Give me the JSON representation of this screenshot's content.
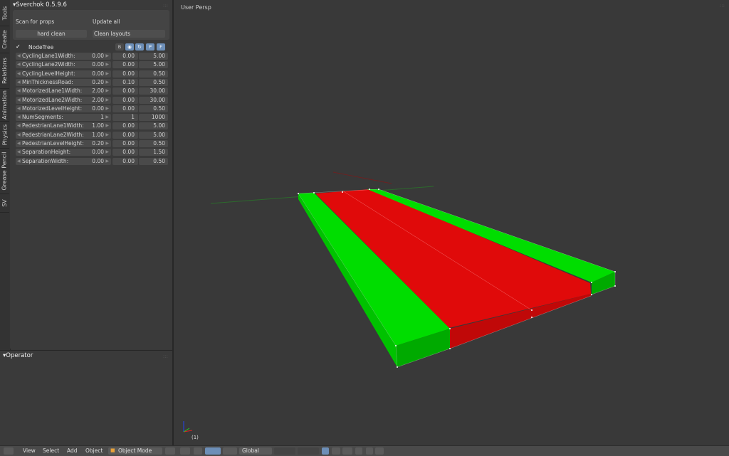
{
  "sidebar_tabs": [
    "Tools",
    "Create",
    "Relations",
    "Animation",
    "Physics",
    "Grease Pencil",
    "SV"
  ],
  "panel": {
    "title": "Sverchok 0.5.9.6",
    "scan_label": "Scan for props",
    "update_label": "Update all",
    "hard_clean_label": "hard clean",
    "clean_layouts_label": "Clean layouts",
    "nodetree_check": "✓",
    "nodetree_label": "NodeTree",
    "nodetree_buttons": {
      "b": "B",
      "p": "P",
      "f": "F"
    },
    "params": [
      {
        "name": "CyclingLane1Width:",
        "value": "0.00",
        "min": "0.00",
        "max": "5.00"
      },
      {
        "name": "CyclingLane2Width:",
        "value": "0.00",
        "min": "0.00",
        "max": "5.00"
      },
      {
        "name": "CyclingLevelHeight:",
        "value": "0.00",
        "min": "0.00",
        "max": "0.50"
      },
      {
        "name": "MinThicknessRoad:",
        "value": "0.20",
        "min": "0.10",
        "max": "0.50"
      },
      {
        "name": "MotorizedLane1Width:",
        "value": "2.00",
        "min": "0.00",
        "max": "30.00"
      },
      {
        "name": "MotorizedLane2Width:",
        "value": "2.00",
        "min": "0.00",
        "max": "30.00"
      },
      {
        "name": "MotorizedLevelHeight:",
        "value": "0.00",
        "min": "0.00",
        "max": "0.50"
      },
      {
        "name": "NumSegments:",
        "value": "1",
        "min": "1",
        "max": "1000"
      },
      {
        "name": "PedestrianLane1Width:",
        "value": "1.00",
        "min": "0.00",
        "max": "5.00"
      },
      {
        "name": "PedestrianLane2Width:",
        "value": "1.00",
        "min": "0.00",
        "max": "5.00"
      },
      {
        "name": "PedestrianLevelHeight:",
        "value": "0.20",
        "min": "0.00",
        "max": "0.50"
      },
      {
        "name": "SeparationHeight:",
        "value": "0.00",
        "min": "0.00",
        "max": "1.50"
      },
      {
        "name": "SeparationWidth:",
        "value": "0.00",
        "min": "0.00",
        "max": "0.50"
      }
    ]
  },
  "operator_panel": {
    "title": "Operator"
  },
  "viewport": {
    "label": "User Persp",
    "frame_label": "(1)",
    "colors": {
      "lane": "#e00a0a",
      "sidewalk": "#00dd00",
      "sidewalk_dark": "#00aa00",
      "x_axis": "#6b2222",
      "y_axis": "#2c6a2c"
    }
  },
  "footer": {
    "menus": [
      "View",
      "Select",
      "Add",
      "Object"
    ],
    "mode_label": "Object Mode",
    "orientation_label": "Global"
  }
}
